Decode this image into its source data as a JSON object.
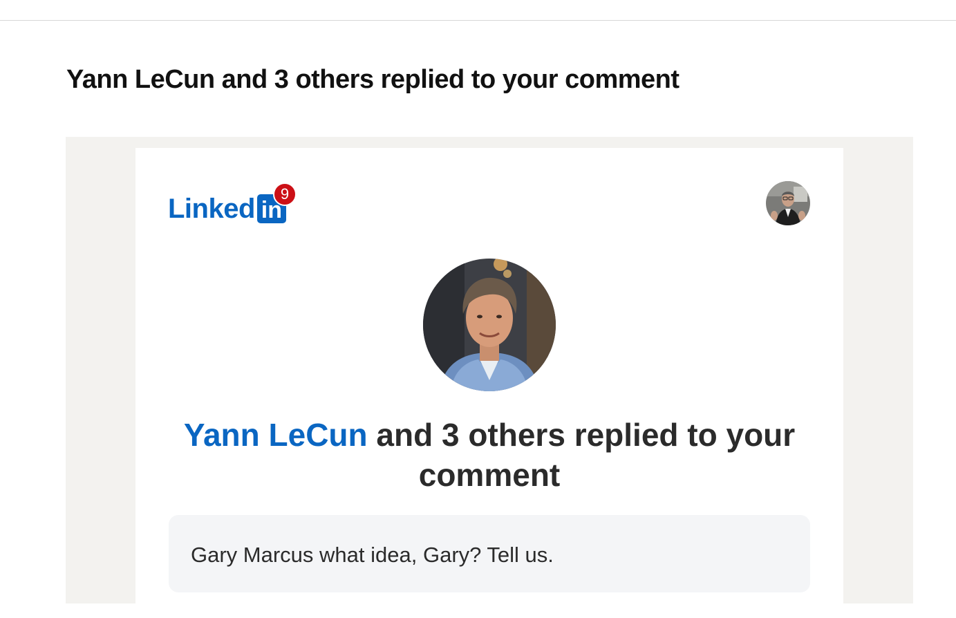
{
  "subject": "Yann LeCun and 3 others replied to your comment",
  "brand": {
    "logo_word": "Linked",
    "logo_box": "in",
    "notification_count": "9",
    "accent_color": "#0a66c2",
    "badge_color": "#cc1016"
  },
  "viewer": {
    "avatar_icon": "profile-photo"
  },
  "notification": {
    "actor_avatar_icon": "profile-photo",
    "actor_name": "Yann LeCun",
    "headline_rest": "and 3 others replied to your comment"
  },
  "comment": {
    "text": "Gary Marcus what idea, Gary? Tell us."
  },
  "colors": {
    "frame_background": "#f3f2ef",
    "card_background": "#ffffff",
    "comment_background": "#f4f5f7"
  }
}
